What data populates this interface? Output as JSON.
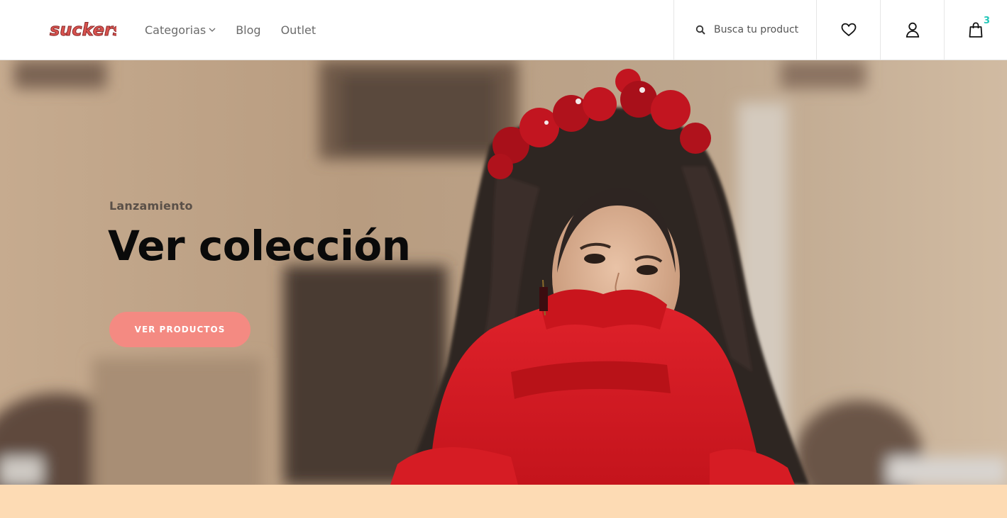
{
  "brand": {
    "name": "suckers",
    "color": "#d9534f"
  },
  "nav": [
    {
      "label": "Categorias",
      "has_dropdown": true
    },
    {
      "label": "Blog"
    },
    {
      "label": "Outlet"
    }
  ],
  "search": {
    "placeholder": "Busca tu product",
    "icon": "search-icon"
  },
  "header_icons": {
    "wishlist": "heart-icon",
    "account": "user-icon",
    "cart": "bag-icon"
  },
  "cart": {
    "count": "3",
    "count_color": "#22c7b8"
  },
  "hero": {
    "subtitle": "Lanzamiento",
    "title": "Ver colección",
    "button_label": "VER PRODUCTOS",
    "button_color": "#f48a82"
  },
  "colors": {
    "band": "#fddbb4",
    "hero_bg": "#b59b80",
    "dress": "#d81b22"
  }
}
